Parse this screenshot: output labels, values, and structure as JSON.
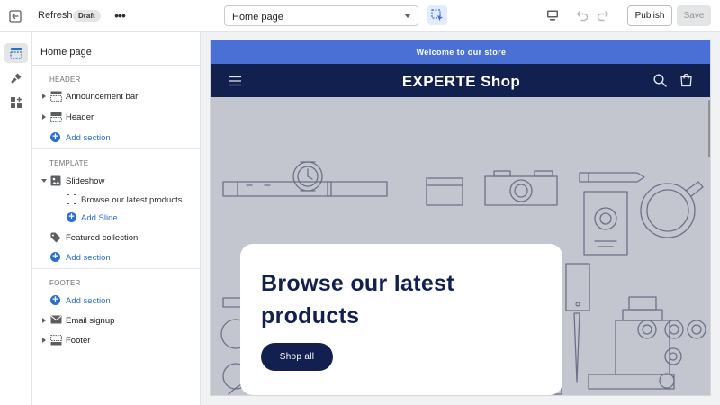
{
  "topbar": {
    "refresh_label": "Refresh",
    "status_badge": "Draft",
    "more_label": "•••",
    "page_select_value": "Home page",
    "publish_label": "Publish",
    "save_label": "Save"
  },
  "rail": {
    "items": [
      "sections-icon",
      "theme-settings-icon",
      "app-blocks-icon"
    ]
  },
  "panel": {
    "title": "Home page",
    "groups": {
      "header": {
        "label": "HEADER",
        "items": [
          "Announcement bar",
          "Header"
        ],
        "add_label": "Add section"
      },
      "template": {
        "label": "TEMPLATE",
        "slideshow": "Slideshow",
        "slide": "Browse our latest products",
        "add_slide": "Add Slide",
        "featured": "Featured collection",
        "add_label": "Add section"
      },
      "footer": {
        "label": "FOOTER",
        "add_label": "Add section",
        "items": [
          "Email signup",
          "Footer"
        ]
      }
    }
  },
  "preview": {
    "announcement": "Welcome to our store",
    "shop_name": "EXPERTE Shop",
    "hero_heading": "Browse our latest products",
    "hero_button": "Shop all"
  },
  "colors": {
    "accent": "#2c6ecb",
    "announcement_bg": "#4a70d6",
    "header_bg": "#12204f",
    "hero_bg": "#c4c6cf"
  }
}
